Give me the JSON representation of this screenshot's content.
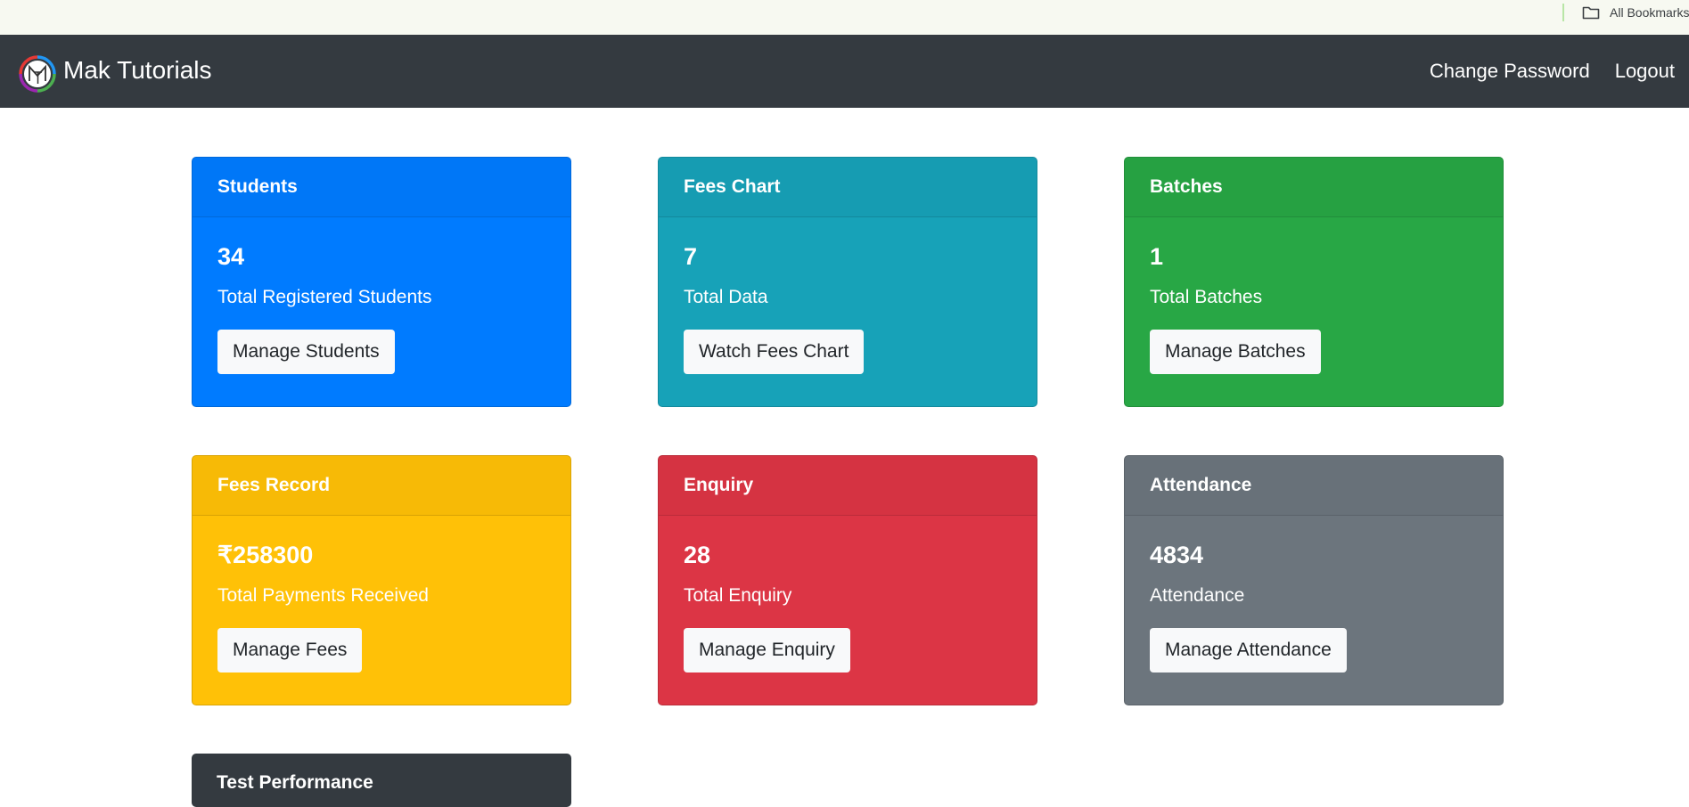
{
  "browser": {
    "bookmarks_label": "All Bookmarks"
  },
  "navbar": {
    "brand": "Mak Tutorials",
    "change_password": "Change Password",
    "logout": "Logout",
    "background": "#343a40"
  },
  "cards": [
    {
      "title": "Students",
      "value": "34",
      "text": "Total Registered Students",
      "button": "Manage Students",
      "color": "#007bff"
    },
    {
      "title": "Fees Chart",
      "value": "7",
      "text": "Total Data",
      "button": "Watch Fees Chart",
      "color": "#17a2b8"
    },
    {
      "title": "Batches",
      "value": "1",
      "text": "Total Batches",
      "button": "Manage Batches",
      "color": "#28a745"
    },
    {
      "title": "Fees Record",
      "value": "₹258300",
      "text": "Total Payments Received",
      "button": "Manage Fees",
      "color": "#ffc107"
    },
    {
      "title": "Enquiry",
      "value": "28",
      "text": "Total Enquiry",
      "button": "Manage Enquiry",
      "color": "#dc3545"
    },
    {
      "title": "Attendance",
      "value": "4834",
      "text": "Attendance",
      "button": "Manage Attendance",
      "color": "#6c757d"
    }
  ],
  "partial_card": {
    "title": "Test Performance",
    "color": "#343a40"
  },
  "icons": {
    "bookmarks": "folder-icon",
    "logo": "mak-tutorials-logo"
  }
}
